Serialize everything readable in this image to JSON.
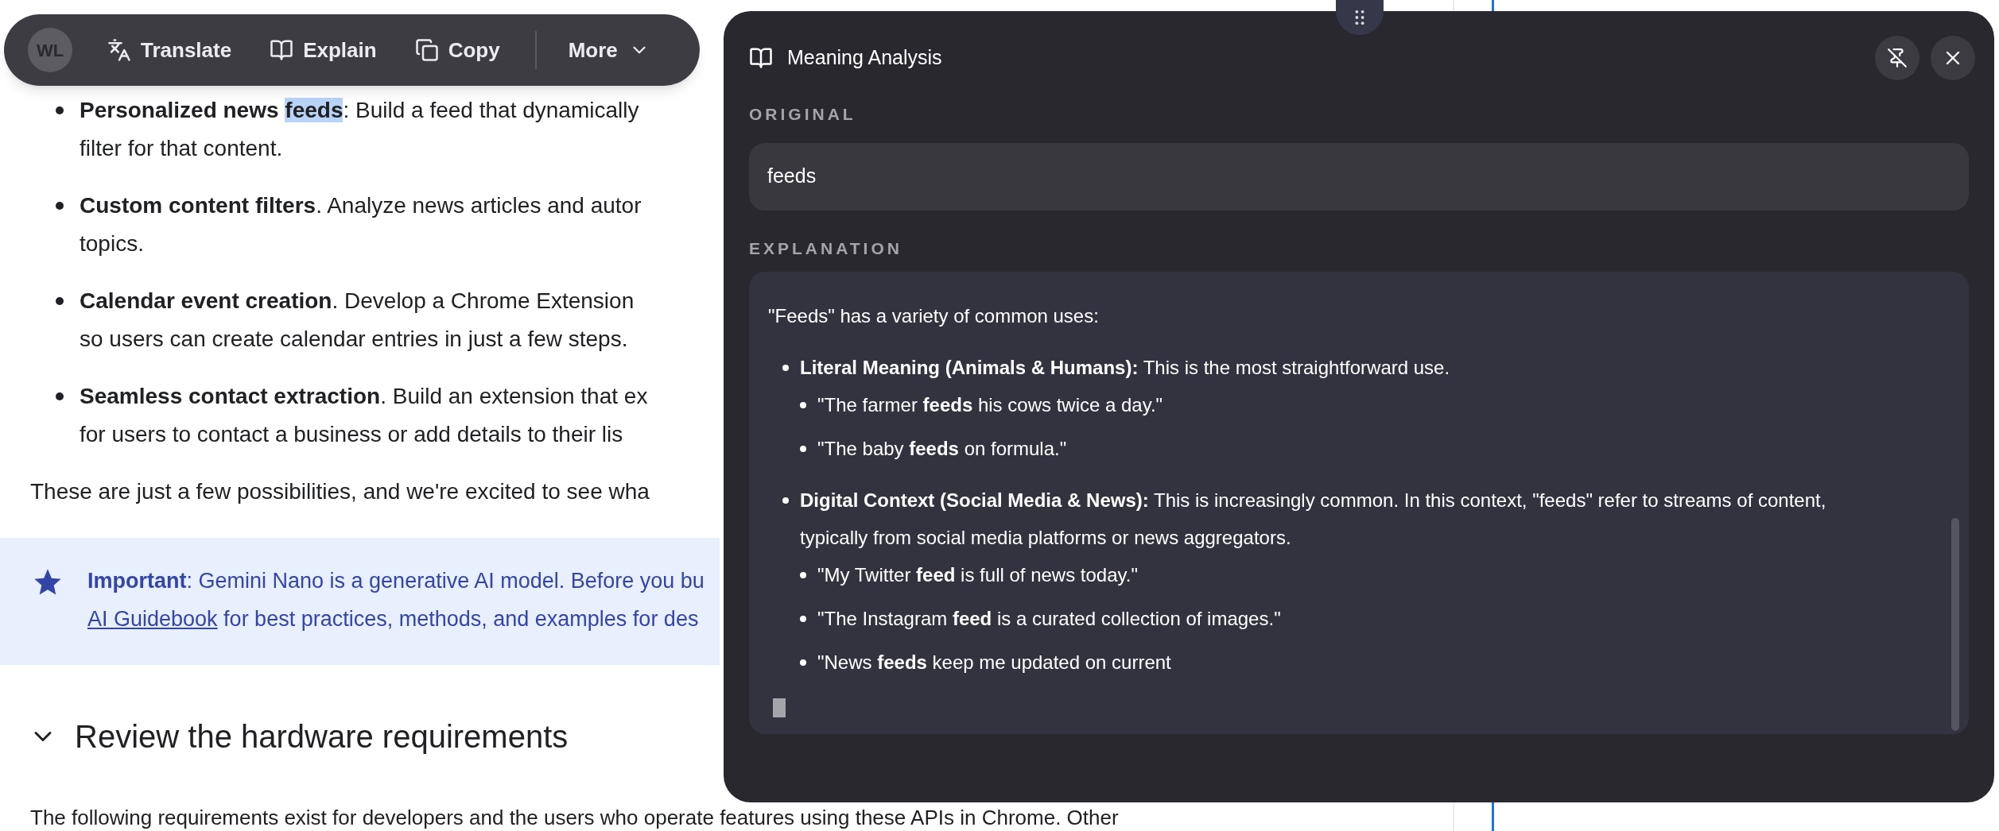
{
  "toolbar": {
    "avatar": "WL",
    "actions": [
      {
        "kind": "translate",
        "label": "Translate"
      },
      {
        "kind": "explain",
        "label": "Explain"
      },
      {
        "kind": "copy",
        "label": "Copy"
      }
    ],
    "more": "More"
  },
  "article": {
    "bullets": [
      {
        "parts": [
          {
            "text": "**Personalized news** ",
            "selected": false
          },
          {
            "text": "**feeds**",
            "selected": true
          },
          {
            "text": ": Build a feed that dynamically",
            "selected": false
          }
        ],
        "continuation": "filter for that content."
      },
      {
        "parts": [
          {
            "text": "**Custom content filters**. Analyze news articles and autor",
            "selected": false
          }
        ],
        "continuation": "topics."
      },
      {
        "parts": [
          {
            "text": "**Calendar event creation**. Develop a Chrome Extension",
            "selected": false
          }
        ],
        "continuation": "so users can create calendar entries in just a few steps."
      },
      {
        "parts": [
          {
            "text": "**Seamless contact extraction**. Build an extension that ex",
            "selected": false
          }
        ],
        "continuation": "for users to contact a business or add details to their lis"
      }
    ],
    "paragraph": "These are just a few possibilities, and we're excited to see wha",
    "callout": {
      "line1": "**Important**: Gemini Nano is a generative AI model. Before you bu",
      "link": "AI Guidebook",
      "line2": " for best practices, methods, and examples for des"
    },
    "heading": "Review the hardware requirements",
    "footer_line": "The following requirements exist for developers and the users who operate features using these APIs in Chrome. Other"
  },
  "panel": {
    "title": "Meaning Analysis",
    "original_label": "ORIGINAL",
    "original": "feeds",
    "explanation_label": "EXPLANATION",
    "intro": "\"Feeds\" has a variety of common uses:",
    "items": [
      {
        "text": "**Literal Meaning (Animals & Humans):** This is the most straightforward use.",
        "children": [
          {
            "text": "\"The farmer **feeds** his cows twice a day.\""
          },
          {
            "text": "\"The baby **feeds** on formula.\""
          }
        ]
      },
      {
        "text": "**Digital Context (Social Media & News):** This is increasingly common. In this context, \"feeds\" refer to streams of content, typically from social media platforms or news aggregators.",
        "children": [
          {
            "text": "\"My Twitter **feed** is full of news today.\""
          },
          {
            "text": "\"The Instagram **feed** is a curated collection of images.\""
          },
          {
            "text": "\"News **feeds** keep me updated on current"
          }
        ]
      }
    ]
  }
}
